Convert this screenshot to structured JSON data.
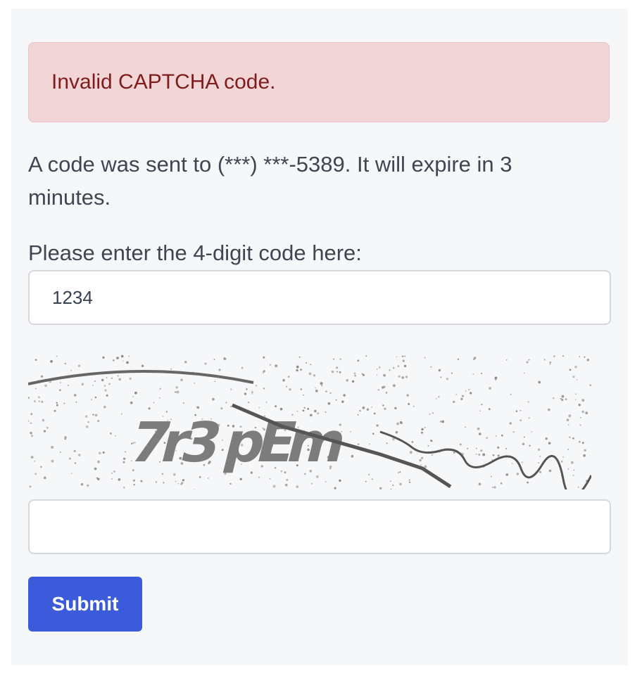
{
  "alert": {
    "message": "Invalid CAPTCHA code."
  },
  "info": {
    "message": "A code was sent to (***) ***-5389. It will expire in 3 minutes."
  },
  "code_field": {
    "label": "Please enter the 4-digit code here:",
    "value": "1234",
    "placeholder": ""
  },
  "captcha": {
    "text": "7r3 pEm"
  },
  "captcha_field": {
    "value": "",
    "placeholder": ""
  },
  "submit": {
    "label": "Submit",
    "color": "#3b5bdb"
  },
  "colors": {
    "alert_background": "#f2d5d7",
    "alert_text": "#7f1d1d",
    "panel_background": "#f6f7f9"
  }
}
